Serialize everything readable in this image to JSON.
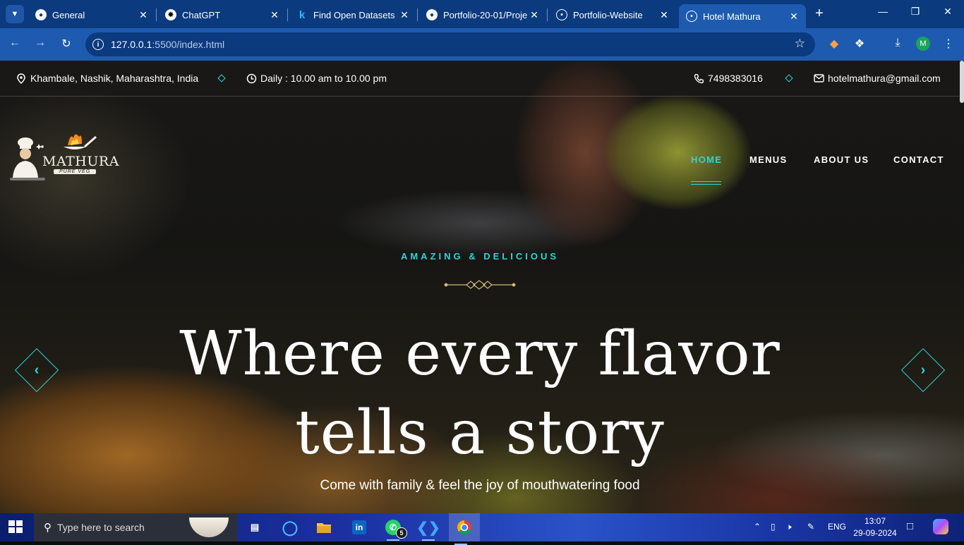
{
  "browser": {
    "tabs": [
      {
        "title": "General",
        "icon": "github-icon"
      },
      {
        "title": "ChatGPT",
        "icon": "chatgpt-icon"
      },
      {
        "title": "Find Open Datasets a",
        "icon": "kaggle-icon"
      },
      {
        "title": "Portfolio-20-01/Proje",
        "icon": "github-icon"
      },
      {
        "title": "Portfolio-Website",
        "icon": "globe-icon"
      },
      {
        "title": "Hotel Mathura",
        "icon": "globe-icon",
        "active": true
      }
    ],
    "address": {
      "host": "127.0.0.1",
      "path": ":5500/index.html"
    },
    "profile_initial": "M"
  },
  "topbar": {
    "location": "Khambale, Nashik, Maharashtra, India",
    "hours": "Daily : 10.00 am to 10.00 pm",
    "phone": "7498383016",
    "email": "hotelmathura@gmail.com"
  },
  "logo": {
    "brand": "MATHURA",
    "sub": "PURE VEG"
  },
  "nav": {
    "home": "HOME",
    "menus": "MENUS",
    "about": "ABOUT US",
    "contact": "CONTACT"
  },
  "hero": {
    "tagline": "AMAZING & DELICIOUS",
    "headline_line1": "Where every flavor",
    "headline_line2": "tells a story",
    "subline": "Come with family & feel the joy of mouthwatering food"
  },
  "taskbar": {
    "search_placeholder": "Type here to search",
    "whatsapp_badge": "5",
    "language": "ENG",
    "time": "13:07",
    "date": "29-09-2024"
  },
  "colors": {
    "accent": "#2ad6dc",
    "tab_strip": "#0b3a7e",
    "toolbar": "#1e5bb0"
  }
}
